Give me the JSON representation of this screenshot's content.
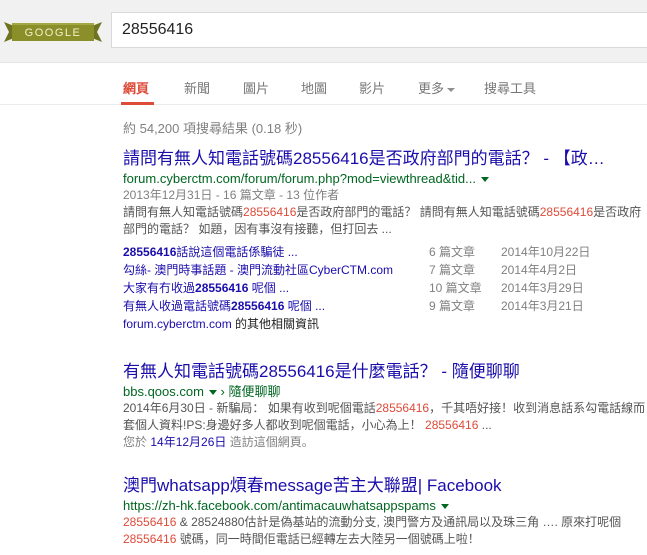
{
  "search": {
    "query": "28556416",
    "logo_text": "GOOGLE"
  },
  "tabs": [
    {
      "label": "網頁"
    },
    {
      "label": "新聞"
    },
    {
      "label": "圖片"
    },
    {
      "label": "地圖"
    },
    {
      "label": "影片"
    },
    {
      "label": "更多"
    },
    {
      "label": "搜尋工具"
    }
  ],
  "stats": "約 54,200 項搜尋結果 (0.18 秒)",
  "results": [
    {
      "title_parts": [
        "請問有無人知電話號碼",
        "28556416",
        "是否政府部門的電話？ - 【政…"
      ],
      "url": "forum.cyberctm.com/forum/forum.php?mod=viewthread&tid...",
      "meta": "2013年12月31日 - 16 篇文章 - 13 位作者",
      "snippet_parts": [
        "請問有無人知電話號碼",
        "28556416",
        "是否政府部門的電話？ 請問有無人知電話號碼",
        "28556416",
        "是否政府部門的電話？ 如題，因有事沒有接聽，但打回去 ..."
      ],
      "sitelinks": [
        {
          "parts": [
            "28556416",
            "話說這個電話係騙徒 ..."
          ],
          "count": "6 篇文章",
          "date": "2014年10月22日"
        },
        {
          "parts": [
            "勾絲- 澳門時事話題 - 澳門流動社區CyberCTM.com",
            ""
          ],
          "count": "7 篇文章",
          "date": "2014年4月2日"
        },
        {
          "parts": [
            "大家有冇收過",
            "28556416",
            " 呢個 ..."
          ],
          "count": "10 篇文章",
          "date": "2014年3月29日"
        },
        {
          "parts": [
            "有無人收過電話號碼",
            "28556416",
            " 呢個 ..."
          ],
          "count": "9 篇文章",
          "date": "2014年3月21日"
        }
      ],
      "more_link": "forum.cyberctm.com",
      "more_text": " 的其他相關資訊"
    },
    {
      "title_parts": [
        "有無人知電話號碼",
        "28556416",
        "是什麼電話？ - 隨便聊聊"
      ],
      "url": "bbs.qoos.com",
      "url_suffix": " › 隨便聊聊",
      "snippet_parts": [
        "2014年6月30日 - 新騙局： 如果有收到呢個電話",
        "28556416",
        "，千其唔好接！收到消息話系勾電話線而套個人資料!PS:身邊好多人都收到呢個電話，小心為上！ ",
        "28556416",
        " ..."
      ],
      "visited_prefix": "您於 ",
      "visited_date": "14年12月26日",
      "visited_suffix": " 造訪這個網頁。"
    },
    {
      "title": "澳門whatsapp煩春message苦主大聯盟| Facebook",
      "url": "https://zh-hk.facebook.com/antimacauwhatsappspams",
      "snippet_parts": [
        "28556416",
        " & 28524880估計是偽基站的流動分支, 澳門警方及通訊局以及珠三角 …. 原來打呢個",
        "28556416",
        " 號碼，同一時間佢電話已經轉左去大陸另一個號碼上啦！"
      ]
    }
  ],
  "colors": {
    "accent": "#dd4b39",
    "link": "#1a0dab",
    "url": "#006621",
    "logo_bg": "#8a8f2a"
  }
}
